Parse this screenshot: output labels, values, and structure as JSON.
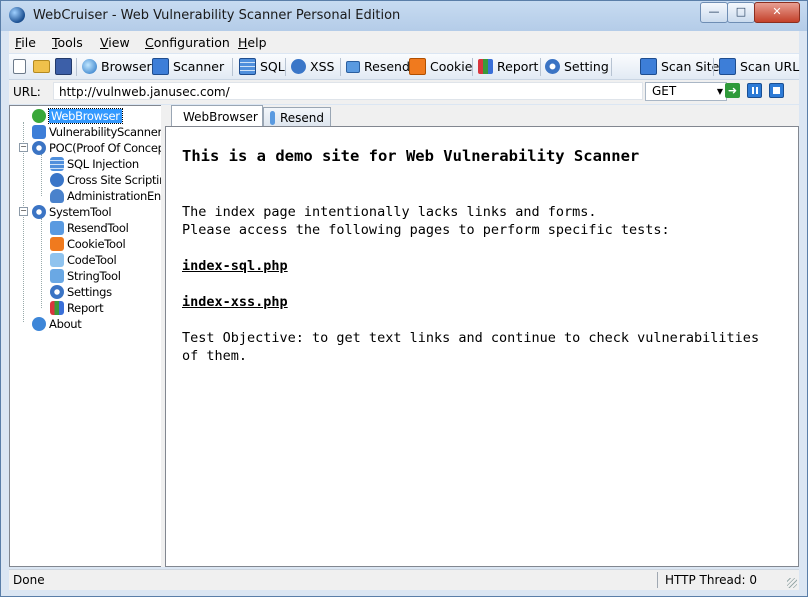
{
  "window": {
    "title": "WebCruiser - Web Vulnerability Scanner Personal Edition"
  },
  "menu": [
    {
      "pre": "",
      "key": "F",
      "post": "ile"
    },
    {
      "pre": "",
      "key": "T",
      "post": "ools"
    },
    {
      "pre": "",
      "key": "V",
      "post": "iew"
    },
    {
      "pre": "",
      "key": "C",
      "post": "onfiguration"
    },
    {
      "pre": "",
      "key": "H",
      "post": "elp"
    }
  ],
  "toolbar": {
    "browser": "Browser",
    "scanner": "Scanner",
    "sql": "SQL",
    "xss": "XSS",
    "resend": "Resend",
    "cookie": "Cookie",
    "report": "Report",
    "setting": "Setting",
    "scan_site": "Scan Site",
    "scan_url": "Scan URL"
  },
  "urlbar": {
    "label": "URL:",
    "value": "http://vulnweb.janusec.com/",
    "method": "GET"
  },
  "tree": {
    "webbrowser": "WebBrowser",
    "scanner": "VulnerabilityScanner",
    "poc": "POC(Proof Of Concept)",
    "sql": "SQL Injection",
    "xss": "Cross Site Scripting",
    "admin": "AdministrationEntrance",
    "systemtool": "SystemTool",
    "resendtool": "ResendTool",
    "cookietool": "CookieTool",
    "codetool": "CodeTool",
    "stringtool": "StringTool",
    "settings": "Settings",
    "report": "Report",
    "about": "About"
  },
  "tabs": {
    "webbrowser": "WebBrowser",
    "resend": "Resend"
  },
  "page": {
    "heading": "This is a demo site for Web Vulnerability Scanner",
    "line1": "The index page intentionally lacks links and forms.",
    "line2": "Please access the following pages to perform specific tests:",
    "link1": "index-sql.php",
    "link2": "index-xss.php",
    "objective1": "Test Objective: to get text links and continue to check vulnerabilities",
    "objective2": "of them."
  },
  "status": {
    "left": "Done",
    "right": "HTTP Thread: 0"
  },
  "colors": {
    "selection": "#3399ff",
    "titlebar": "#b4cce8",
    "close": "#c4412a"
  }
}
